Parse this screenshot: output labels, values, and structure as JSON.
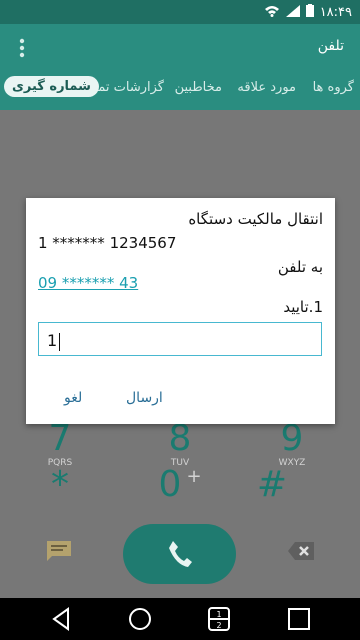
{
  "status": {
    "time": "۱۸:۴۹"
  },
  "appbar": {
    "title": "تلفن"
  },
  "tabs": [
    {
      "label": "گروه ها"
    },
    {
      "label": "مورد علاقه"
    },
    {
      "label": "مخاطبین"
    },
    {
      "label": "گزارشات تماس"
    },
    {
      "label": "شماره گیری"
    }
  ],
  "dialer": {
    "keys": [
      {
        "num": "7",
        "letters": "PQRS"
      },
      {
        "num": "8",
        "letters": "TUV"
      },
      {
        "num": "9",
        "letters": "WXYZ"
      },
      {
        "num": "*",
        "letters": ""
      },
      {
        "num": "0",
        "letters": "+"
      },
      {
        "num": "#",
        "letters": ""
      }
    ]
  },
  "dialog": {
    "title": "انتقال مالکیت دستگاه",
    "line1": "1 ******* 1234567",
    "line2": "به تلفن",
    "link": "09 ******* 43",
    "line3": "1.تایید",
    "input_value": "1",
    "send_label": "ارسال",
    "cancel_label": "لغو"
  }
}
